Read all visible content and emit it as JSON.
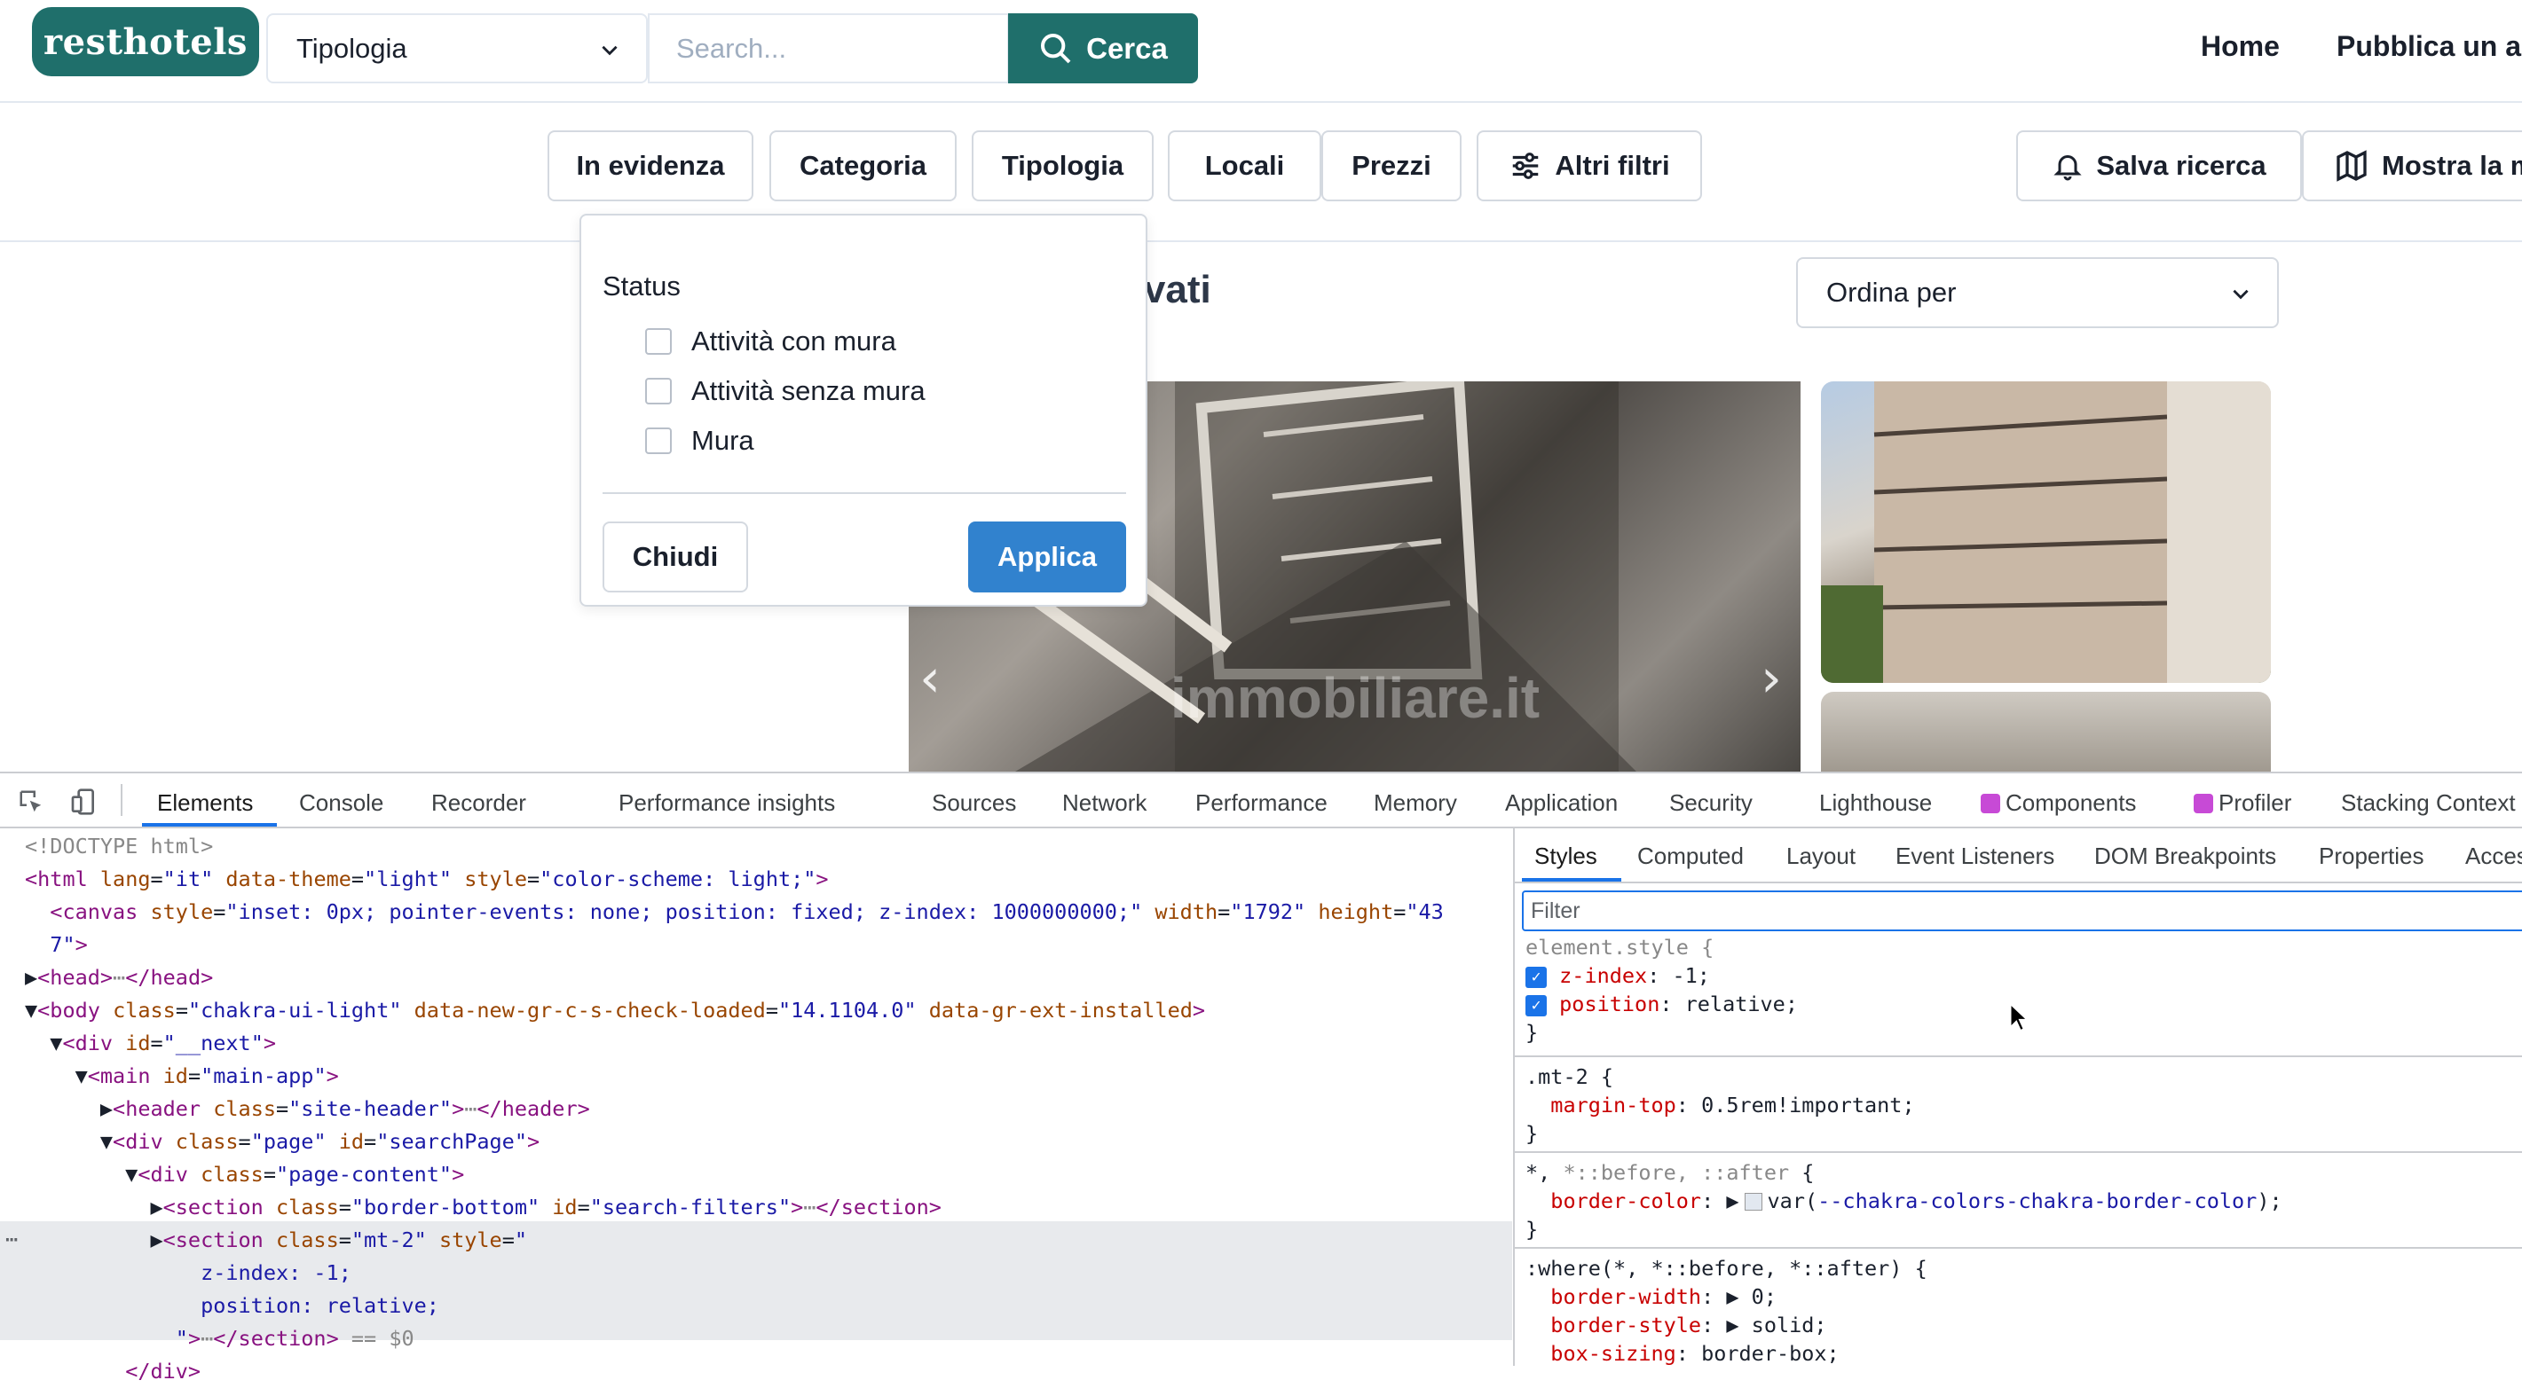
{
  "header": {
    "logo": "resthotels",
    "type_select": "Tipologia",
    "search_placeholder": "Search...",
    "search_button": "Cerca",
    "nav": [
      "Home",
      "Pubblica un ar"
    ]
  },
  "filters": {
    "buttons": [
      "In evidenza",
      "Categoria",
      "Tipologia",
      "Locali",
      "Prezzi",
      "Altri filtri"
    ],
    "save_search": "Salva ricerca",
    "show_map": "Mostra la m"
  },
  "popover": {
    "title": "Status",
    "options": [
      "Attività con mura",
      "Attività senza mura",
      "Mura"
    ],
    "close": "Chiudi",
    "apply": "Applica"
  },
  "results": {
    "title_fragment": "ovati",
    "order_by": "Ordina per",
    "watermark": "immobiliare.it"
  },
  "devtools": {
    "tabs": [
      "Elements",
      "Console",
      "Recorder",
      "Performance insights",
      "Sources",
      "Network",
      "Performance",
      "Memory",
      "Application",
      "Security",
      "Lighthouse",
      "Components",
      "Profiler",
      "Stacking Context"
    ],
    "styles_tabs": [
      "Styles",
      "Computed",
      "Layout",
      "Event Listeners",
      "DOM Breakpoints",
      "Properties",
      "Acces"
    ],
    "filter_placeholder": "Filter",
    "selected_marker": "== $0"
  },
  "colors": {
    "brand": "#1f6f6b",
    "apply": "#3182ce",
    "devtools_accent": "#1a73e8"
  }
}
